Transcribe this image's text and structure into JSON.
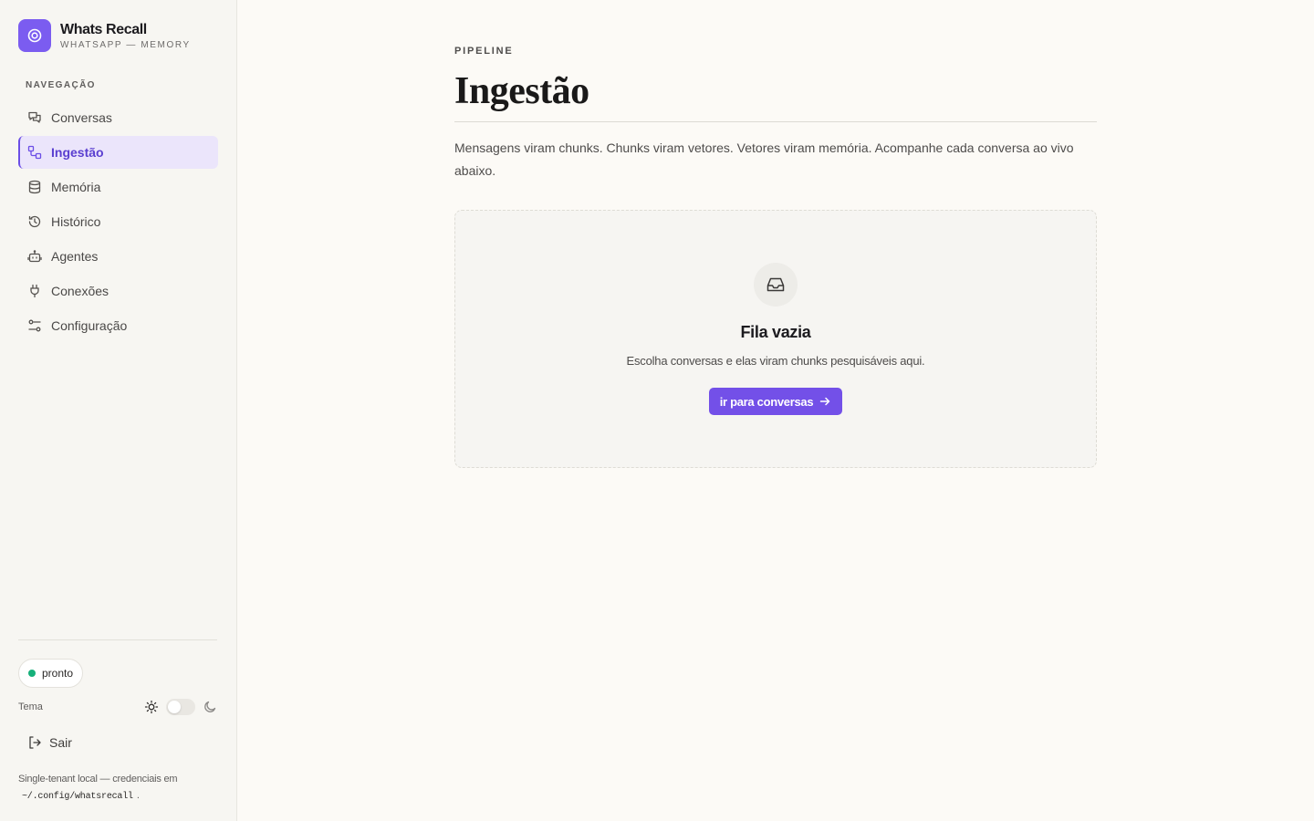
{
  "colors": {
    "accent": "#7350e8",
    "accent_soft": "#ebe5fb",
    "status_ok": "#16b07a",
    "background": "#fcfaf6",
    "sidebar_bg": "#f7f6f2"
  },
  "brand": {
    "icon": "target-icon",
    "title": "Whats Recall",
    "subtitle": "WHATSAPP — MEMORY"
  },
  "sidebar": {
    "heading": "NAVEGAÇÃO",
    "items": [
      {
        "label": "Conversas",
        "icon": "chat-bubbles-icon",
        "active": false
      },
      {
        "label": "Ingestão",
        "icon": "workflow-icon",
        "active": true
      },
      {
        "label": "Memória",
        "icon": "database-icon",
        "active": false
      },
      {
        "label": "Histórico",
        "icon": "history-icon",
        "active": false
      },
      {
        "label": "Agentes",
        "icon": "bot-icon",
        "active": false
      },
      {
        "label": "Conexões",
        "icon": "plug-icon",
        "active": false
      },
      {
        "label": "Configuração",
        "icon": "settings-sliders-icon",
        "active": false
      }
    ],
    "status": "pronto",
    "theme_label": "Tema",
    "theme_mode": "light",
    "logout_label": "Sair",
    "footnote_text": "Single-tenant local — credenciais em",
    "footnote_path": "~/.config/whatsrecall",
    "footnote_end": "."
  },
  "main": {
    "eyebrow": "PIPELINE",
    "title": "Ingestão",
    "lead": "Mensagens viram chunks. Chunks viram vetores. Vetores viram memória. Acompanhe cada conversa ao vivo abaixo.",
    "empty": {
      "icon": "inbox-icon",
      "title": "Fila vazia",
      "description": "Escolha conversas e elas viram chunks pesquisáveis aqui.",
      "cta_label": "ir para conversas",
      "cta_icon": "arrow-right-icon"
    }
  }
}
